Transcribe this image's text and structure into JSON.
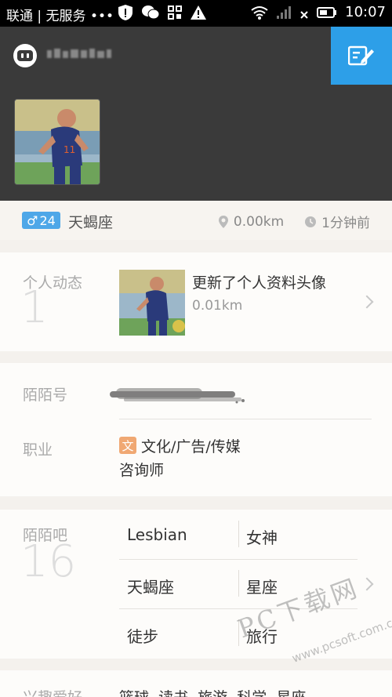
{
  "status_bar": {
    "carrier": "联通 | 无服务 •••",
    "time": "10:07"
  },
  "profile": {
    "gender_symbol": "♂",
    "age": "24",
    "zodiac": "天蝎座",
    "distance": "0.00km",
    "last_seen": "1分钟前"
  },
  "feed": {
    "label": "个人动态",
    "count": "1",
    "title": "更新了个人资料头像",
    "distance": "0.01km"
  },
  "details": {
    "momo_label": "陌陌号",
    "job_label": "职业",
    "job_tag": "文",
    "job_industry": "文化/广告/传媒",
    "job_title": "咨询师"
  },
  "tribes": {
    "label": "陌陌吧",
    "count": "16",
    "items": [
      "Lesbian",
      "女神",
      "天蝎座",
      "星座",
      "徒步",
      "旅行"
    ]
  },
  "interests": {
    "label": "兴趣爱好",
    "items": "篮球  读书  旅游  科学  星座"
  },
  "watermark": {
    "main": "PC下载网",
    "sub": "www.pcsoft.com.cn"
  },
  "colors": {
    "header_bg": "#3a3a3a",
    "accent_blue": "#2d9fe8",
    "age_badge": "#4ea7e8",
    "job_tag": "#f0a873"
  }
}
